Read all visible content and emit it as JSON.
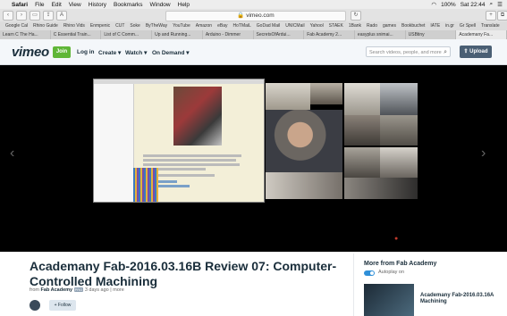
{
  "menubar": {
    "items": [
      "Safari",
      "File",
      "Edit",
      "View",
      "History",
      "Bookmarks",
      "Window",
      "Help"
    ],
    "status": {
      "battery": "100%",
      "time": "Sat 22:44"
    }
  },
  "toolbar": {
    "url": "vimeo.com",
    "reader": "A"
  },
  "bookmarks": [
    "Google Cal",
    "Rhino Guide",
    "Rhino Vids",
    "Enmpenic",
    "CUT",
    "Soke",
    "ByTheWay",
    "YouTube",
    "Amazon",
    "eBay",
    "HoTMaiL",
    "GoDad Mail",
    "UNICMail",
    "Yahool",
    "STAEK",
    "1Bank",
    "Rado",
    "games",
    "Bookbuchet",
    "IATE",
    "in.gr",
    "Gr Spell",
    "Translate"
  ],
  "tabs": [
    "Learn C The Ha...",
    "C Essential Train...",
    "List of C Comm...",
    "Up and Running...",
    "Arduino - Dimmer",
    "SecretsOfArdui...",
    "Fab Academy 2...",
    "easyplus snimai...",
    "USBtiny",
    "Academany Fa..."
  ],
  "header": {
    "logo": "vimeo",
    "join": "Join",
    "login": "Log in",
    "create": "Create ▾",
    "watch": "Watch ▾",
    "ondemand": "On Demand ▾",
    "search_placeholder": "Search videos, people, and more",
    "upload": "Upload"
  },
  "video": {
    "title": "Academany Fab-2016.03.16B Review 07: Computer-Controlled Machining",
    "byline_prefix": "from",
    "channel": "Fab Academy",
    "pro": "PRO",
    "age": "3 days ago",
    "more": "more",
    "follow": "Follow"
  },
  "sidebar": {
    "title": "More from Fab Academy",
    "autoplay": "Autoplay on",
    "related_title": "Academany Fab-2016.03.16A Machining"
  },
  "colors": {
    "accent": "#5fb637",
    "brand": "#1a2e3b",
    "player_bg": "#000000"
  }
}
